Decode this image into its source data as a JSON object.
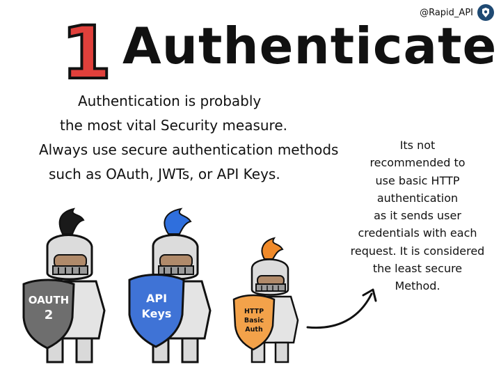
{
  "handle": {
    "text": "@Rapid_API",
    "icon": "rapidapi-logo-icon"
  },
  "heading": {
    "number": "1",
    "title": "Authenticate"
  },
  "intro": {
    "lines": [
      "Authentication is probably",
      "the most vital Security measure.",
      "Always use secure authentication methods",
      "such as OAuth, JWTs, or API Keys."
    ]
  },
  "knights": [
    {
      "shield_lines": [
        "OAUTH",
        "2"
      ],
      "plume_color": "#1a1a1a",
      "shield_color": "#6e6e6e"
    },
    {
      "shield_lines": [
        "API",
        "Keys"
      ],
      "plume_color": "#2f6fdd",
      "shield_color": "#3f73d6"
    },
    {
      "shield_lines": [
        "HTTP",
        "Basic",
        "Auth"
      ],
      "plume_color": "#f08a2a",
      "shield_color": "#f3a24a"
    }
  ],
  "note": {
    "lines": [
      "Its not",
      "recommended to",
      "use basic HTTP",
      "authentication",
      "as it sends user",
      "credentials with each",
      "request. It is considered",
      "the least secure",
      "Method."
    ]
  },
  "colors": {
    "accent_red": "#e0403b",
    "ink": "#111111",
    "armor": "#d9d9d9"
  }
}
